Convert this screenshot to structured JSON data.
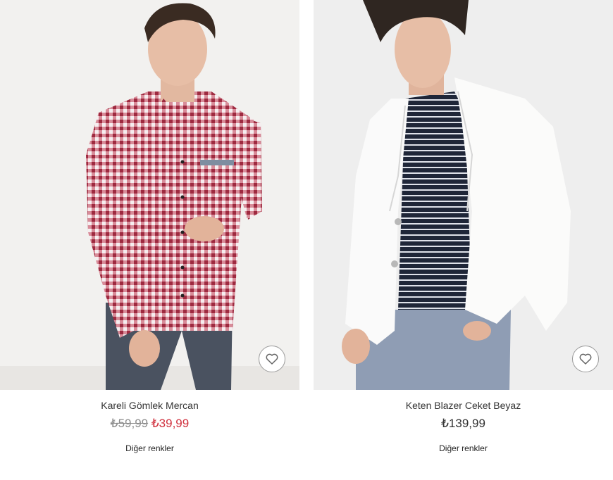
{
  "products": [
    {
      "name": "Kareli Gömlek Mercan",
      "old_price": "₺59,99",
      "price": "₺39,99",
      "other_colors": "Diğer renkler",
      "favorite_icon": "heart-outline-icon"
    },
    {
      "name": "Keten Blazer Ceket Beyaz",
      "price": "₺139,99",
      "other_colors": "Diğer renkler",
      "favorite_icon": "heart-outline-icon"
    }
  ],
  "colors": {
    "sale_price": "#d0313e",
    "old_price": "#8c8c8c",
    "text": "#333333"
  }
}
